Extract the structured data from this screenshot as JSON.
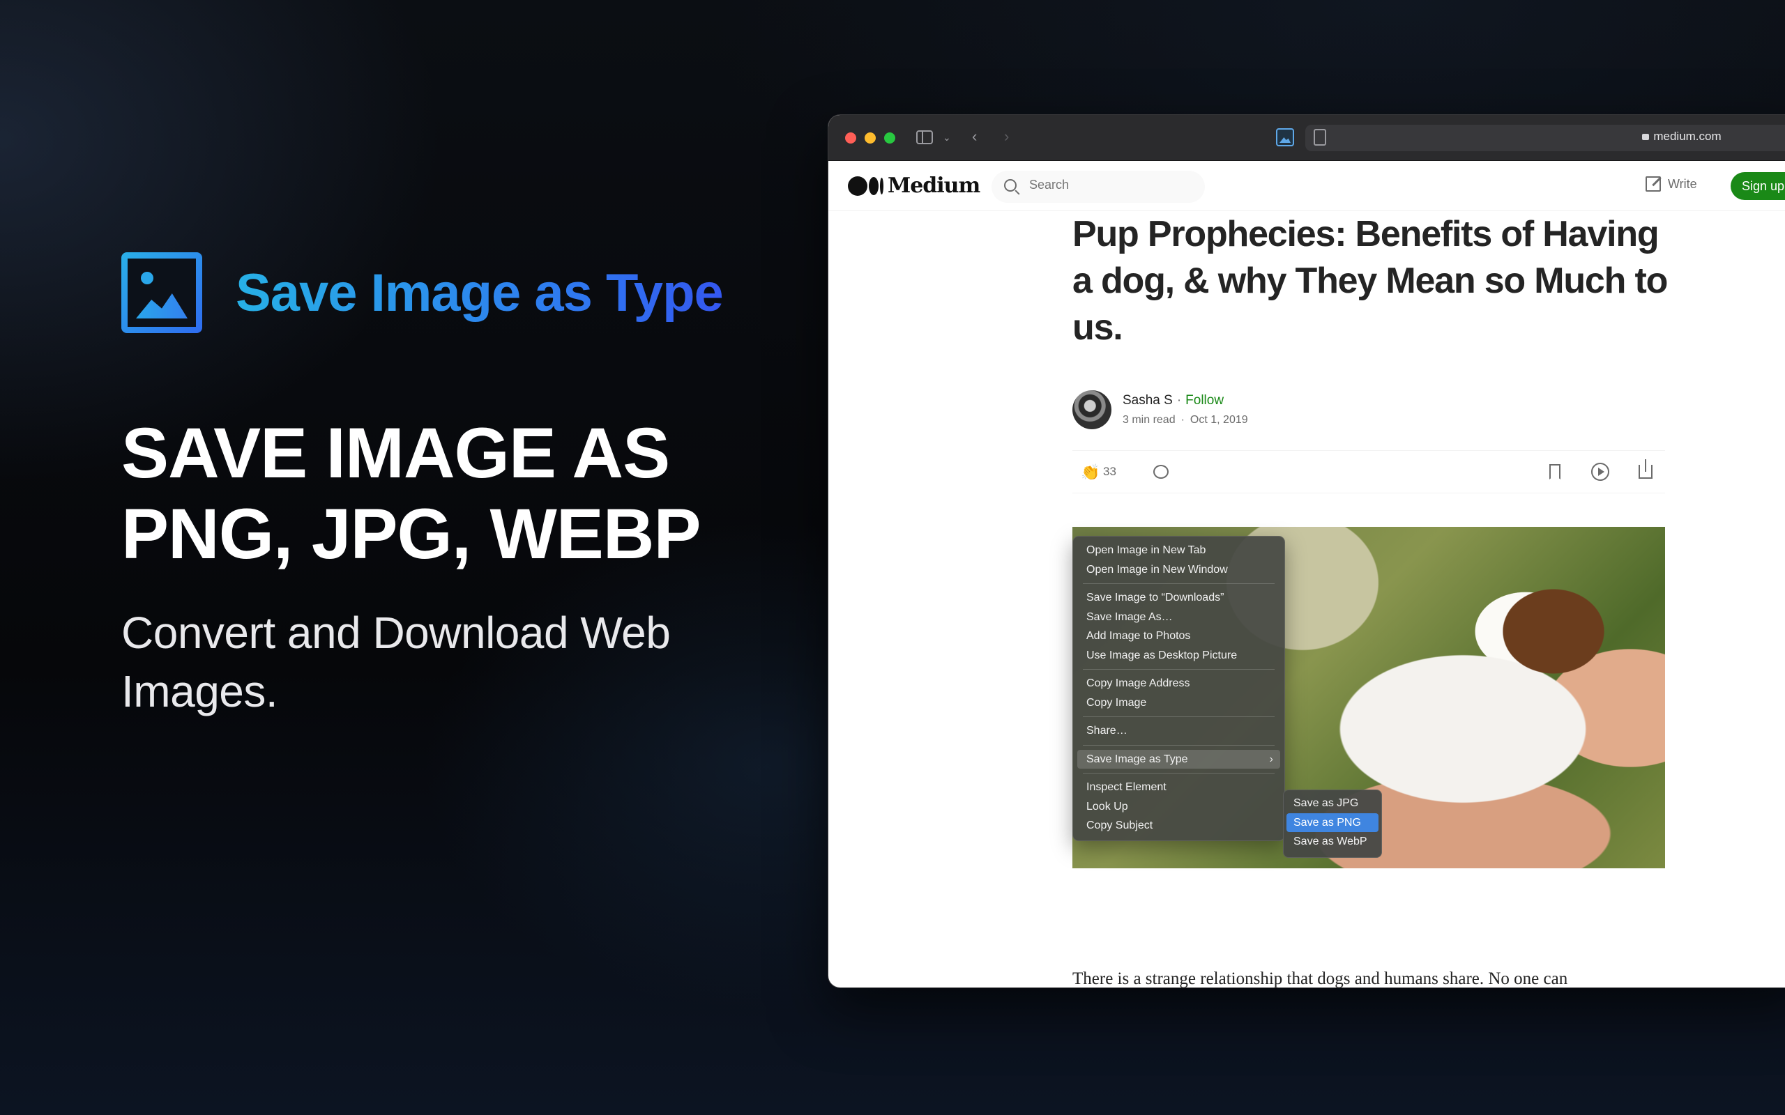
{
  "promo": {
    "brand_name": "Save Image as Type",
    "headline_line1": "SAVE IMAGE AS",
    "headline_line2": "PNG, JPG, WEBP",
    "subhead": "Convert and Download Web Images."
  },
  "browser": {
    "url": "medium.com"
  },
  "medium": {
    "logo_text": "Medium",
    "search_placeholder": "Search",
    "write_label": "Write",
    "signup_label": "Sign up"
  },
  "article": {
    "title": "Pup Prophecies: Benefits of Having a dog, & why They Mean so Much to us.",
    "author": "Sasha S",
    "follow_label": "Follow",
    "read_time": "3 min read",
    "date": "Oct 1, 2019",
    "clap_count": "33",
    "body_first_line": "There is a strange relationship that dogs and humans share. No one can"
  },
  "context_menu": {
    "items": [
      "Open Image in New Tab",
      "Open Image in New Window",
      "Save Image to “Downloads”",
      "Save Image As…",
      "Add Image to Photos",
      "Use Image as Desktop Picture",
      "Copy Image Address",
      "Copy Image",
      "Share…",
      "Save Image as Type",
      "Inspect Element",
      "Look Up",
      "Copy Subject"
    ],
    "submenu": [
      "Save as JPG",
      "Save as PNG",
      "Save as WebP"
    ],
    "highlighted_submenu_item": "Save as PNG"
  },
  "colors": {
    "brand_gradient_start": "#27b0e6",
    "brand_gradient_end": "#3457ef",
    "medium_green": "#1a8917",
    "menu_highlight": "#3f85e0"
  }
}
